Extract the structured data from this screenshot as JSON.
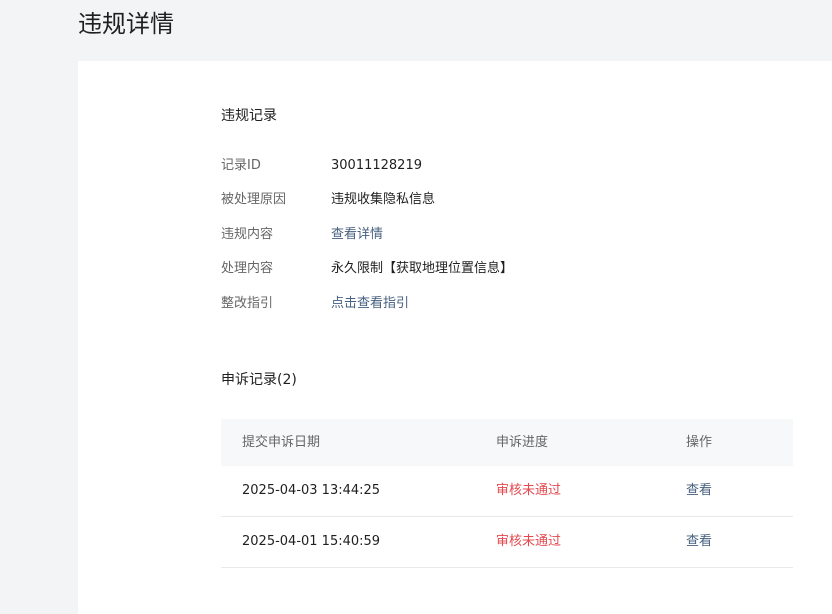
{
  "page": {
    "title": "违规详情"
  },
  "violation": {
    "section_title": "违规记录",
    "fields": [
      {
        "label": "记录ID",
        "value": "30011128219"
      },
      {
        "label": "被处理原因",
        "value": "违规收集隐私信息"
      },
      {
        "label": "违规内容",
        "value": "查看详情"
      },
      {
        "label": "处理内容",
        "value": "永久限制【获取地理位置信息】"
      },
      {
        "label": "整改指引",
        "value": "点击查看指引"
      }
    ]
  },
  "appeals": {
    "section_title": "申诉记录(2)",
    "columns": [
      "提交申诉日期",
      "申诉进度",
      "操作"
    ],
    "rows": [
      {
        "date": "2025-04-03 13:44:25",
        "status": "审核未通过",
        "action": "查看"
      },
      {
        "date": "2025-04-01 15:40:59",
        "status": "审核未通过",
        "action": "查看"
      }
    ]
  },
  "colors": {
    "link": "#46607f",
    "status_rejected": "#e5484d",
    "table_header_bg": "#f7f8fa",
    "page_bg": "#f3f4f6"
  }
}
